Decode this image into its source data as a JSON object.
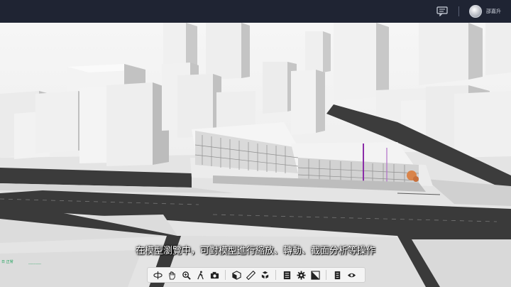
{
  "header": {
    "user_name": "邵嘉升",
    "icons": [
      "chat-icon",
      "avatar"
    ]
  },
  "viewer": {
    "subtitle": "在模型瀏覽中，可對模型進行縮放、轉動、截面分析等操作",
    "corner_labels": [
      "日 正常",
      "----------"
    ]
  },
  "toolbar": {
    "groups": [
      [
        "orbit-icon",
        "pan-hand-icon",
        "zoom-icon",
        "walk-icon",
        "camera-icon"
      ],
      [
        "section-box-icon",
        "measure-icon",
        "explode-icon"
      ],
      [
        "model-tree-icon",
        "settings-icon",
        "properties-icon"
      ],
      [
        "document-icon",
        "visibility-icon"
      ]
    ]
  },
  "colors": {
    "topbar": "#1f2433",
    "toolbar": "#f4f4f4",
    "building": "#ececec",
    "road": "#3a3a3a",
    "accent_purple": "#8a2ca8",
    "accent_orange": "#d9844a"
  }
}
